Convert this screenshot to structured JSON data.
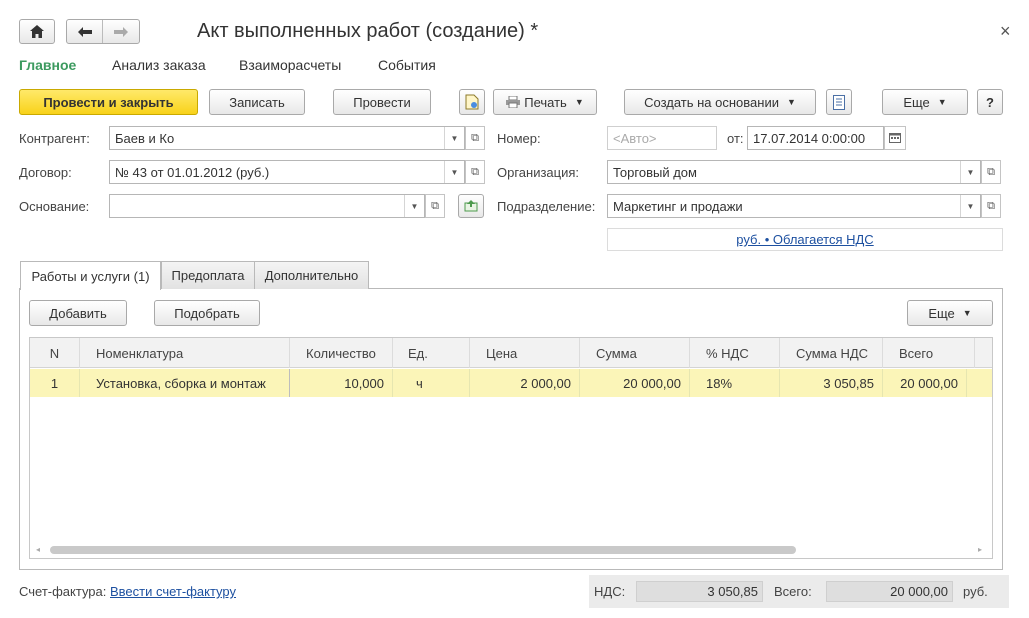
{
  "window": {
    "title": "Акт выполненных работ (создание) *",
    "close_glyph": "×"
  },
  "nav_tabs": [
    {
      "label": "Главное",
      "active": true
    },
    {
      "label": "Анализ заказа"
    },
    {
      "label": "Взаиморасчеты"
    },
    {
      "label": "События"
    }
  ],
  "toolbar": {
    "post_close": "Провести и закрыть",
    "save": "Записать",
    "post": "Провести",
    "print": "Печать",
    "create_based": "Создать на основании",
    "more": "Еще",
    "help": "?"
  },
  "form": {
    "counterparty_label": "Контрагент:",
    "counterparty_value": "Баев и Ко",
    "contract_label": "Договор:",
    "contract_value": "№ 43 от 01.01.2012 (руб.)",
    "basis_label": "Основание:",
    "basis_value": "",
    "number_label": "Номер:",
    "number_placeholder": "<Авто>",
    "from_label": "от:",
    "date_value": "17.07.2014  0:00:00",
    "org_label": "Организация:",
    "org_value": "Торговый дом",
    "division_label": "Подразделение:",
    "division_value": "Маркетинг и продажи",
    "vat_link": "руб. • Облагается НДС"
  },
  "inner_tabs": [
    {
      "label": "Работы и услуги (1)",
      "active": true
    },
    {
      "label": "Предоплата"
    },
    {
      "label": "Дополнительно"
    }
  ],
  "table_toolbar": {
    "add": "Добавить",
    "pick": "Подобрать",
    "more": "Еще"
  },
  "table": {
    "columns": [
      "N",
      "Номенклатура",
      "Количество",
      "Ед.",
      "Цена",
      "Сумма",
      "% НДС",
      "Сумма НДС",
      "Всего"
    ],
    "rows": [
      [
        "1",
        "Установка, сборка и монтаж",
        "10,000",
        "ч",
        "2 000,00",
        "20 000,00",
        "18%",
        "3 050,85",
        "20 000,00"
      ]
    ]
  },
  "footer": {
    "invoice_label": "Счет-фактура:",
    "invoice_link": "Ввести счет-фактуру",
    "vat_label": "НДС:",
    "vat_value": "3 050,85",
    "total_label": "Всего:",
    "total_value": "20 000,00",
    "currency": "руб."
  },
  "colors": {
    "accent_green": "#3c9a5f",
    "primary_button": "#f8d21a",
    "row_highlight": "#fbf5b8",
    "link": "#1d50a0"
  }
}
